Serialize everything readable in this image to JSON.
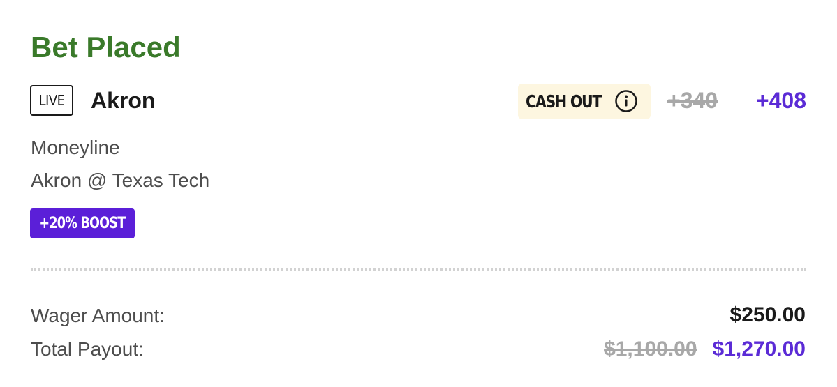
{
  "bet": {
    "status_title": "Bet Placed",
    "live_label": "LIVE",
    "selection": "Akron",
    "cash_out_label": "CASH OUT",
    "odds_original": "+340",
    "odds_boosted": "+408",
    "market": "Moneyline",
    "matchup": "Akron @ Texas Tech",
    "boost_label": "+20% BOOST"
  },
  "summary": {
    "wager_label": "Wager Amount:",
    "wager_value": "$250.00",
    "payout_label": "Total Payout:",
    "payout_original": "$1,100.00",
    "payout_boosted": "$1,270.00"
  },
  "icons": {
    "cash_out_info": "info-circle-icon"
  },
  "colors": {
    "status_green": "#3a7a2a",
    "boost_purple": "#5b1fd8",
    "boosted_text_purple": "#5b2bd6",
    "cash_out_bg": "#fdf6e0",
    "struck_gray": "#a8a8a8"
  }
}
